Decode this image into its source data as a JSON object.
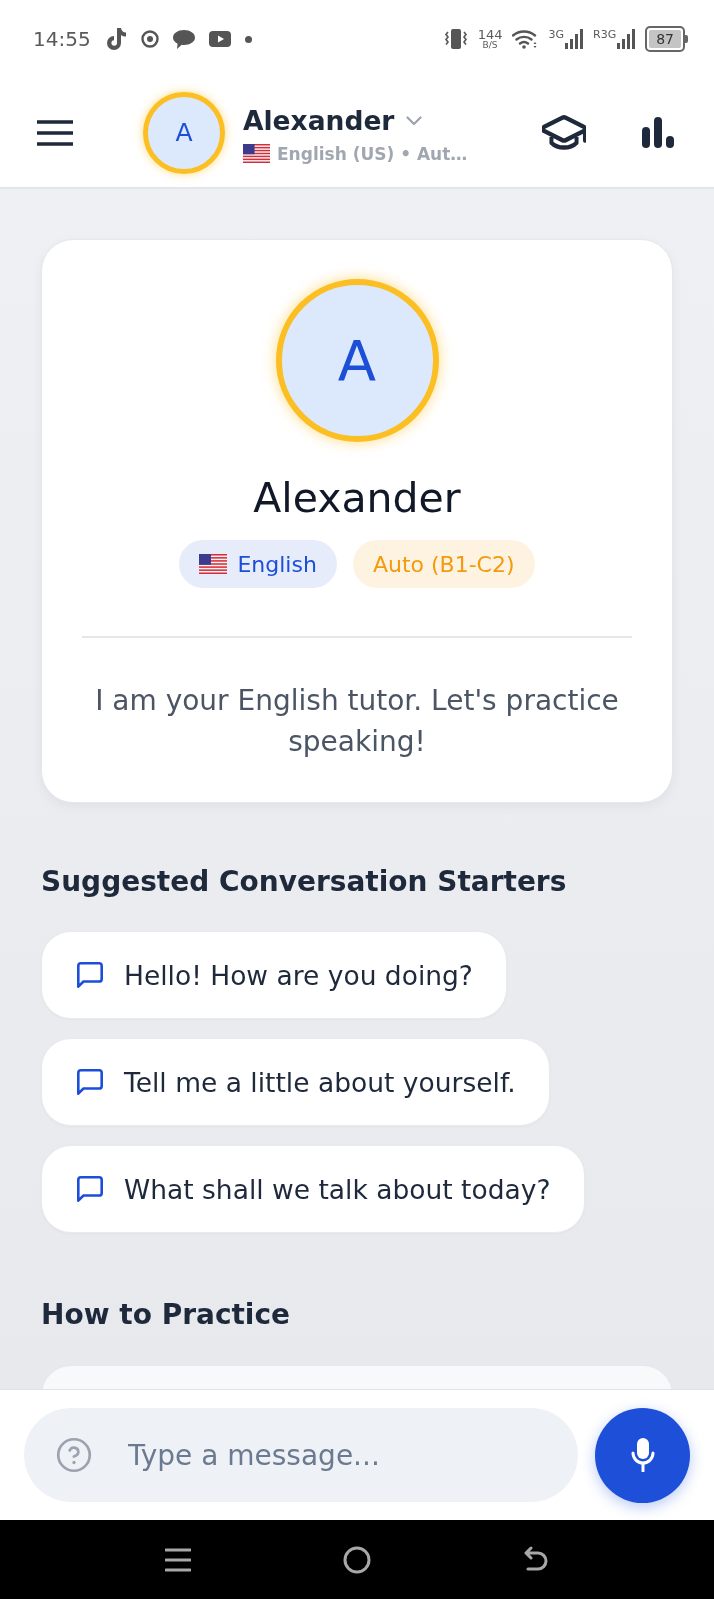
{
  "status_bar": {
    "time": "14:55",
    "data_rate": "144",
    "data_rate_unit": "B/S",
    "network_1": "3G",
    "network_2": "R3G",
    "battery": "87"
  },
  "header": {
    "avatar_letter": "A",
    "name": "Alexander",
    "subtitle": "English (US) • Aut…"
  },
  "profile_card": {
    "avatar_letter": "A",
    "name": "Alexander",
    "tags": [
      {
        "kind": "language",
        "label": "English"
      },
      {
        "kind": "level",
        "label": "Auto (B1-C2)"
      }
    ],
    "description": "I am your English tutor. Let's practice speaking!"
  },
  "conversation_starters": {
    "title": "Suggested Conversation Starters",
    "items": [
      "Hello! How are you doing?",
      "Tell me a little about yourself.",
      "What shall we talk about today?"
    ]
  },
  "how_to_practice": {
    "title": "How to Practice"
  },
  "composer": {
    "placeholder": "Type a message..."
  }
}
